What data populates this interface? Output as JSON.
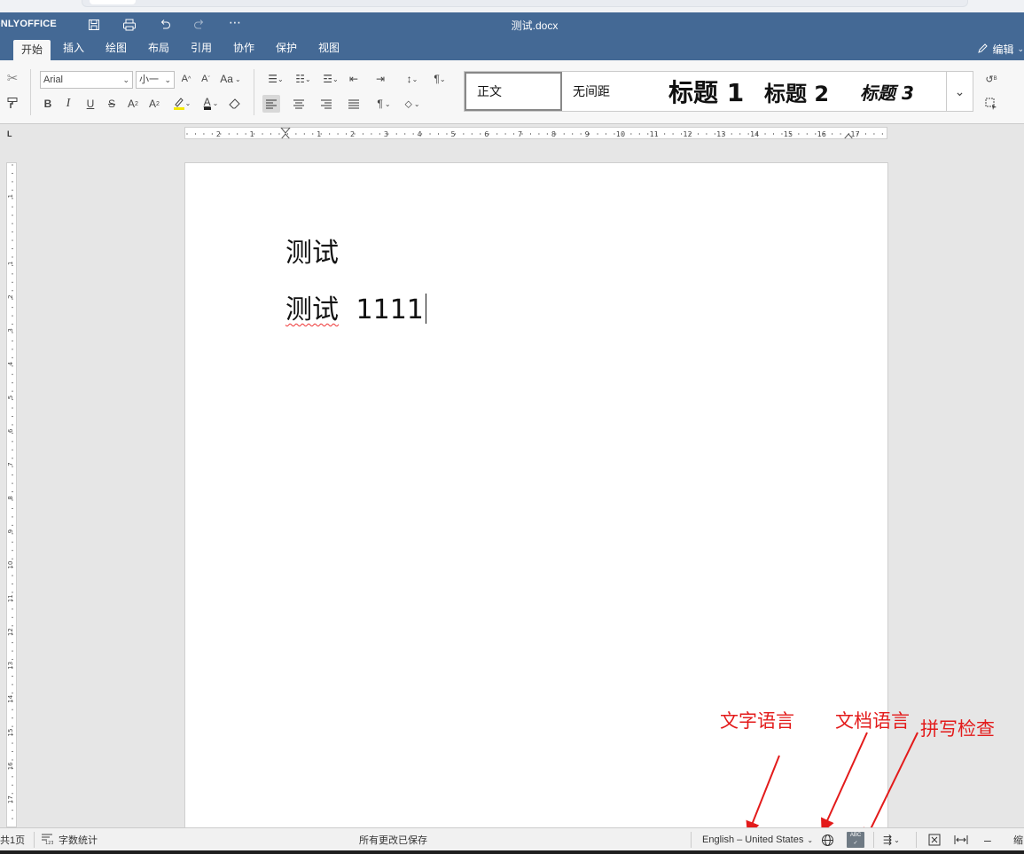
{
  "app": {
    "logo_text": "ONLYOFFICE",
    "doc_title": "测试.docx"
  },
  "quick_access": [
    "save-icon",
    "print-icon",
    "undo-icon",
    "redo-icon",
    "more-icon"
  ],
  "tabs": [
    {
      "label": "开始",
      "active": true
    },
    {
      "label": "插入"
    },
    {
      "label": "绘图"
    },
    {
      "label": "布局"
    },
    {
      "label": "引用"
    },
    {
      "label": "协作"
    },
    {
      "label": "保护"
    },
    {
      "label": "视图"
    }
  ],
  "mode": {
    "label": "编辑",
    "icon": "pencil-icon"
  },
  "font": {
    "name": "Arial",
    "size": "小一"
  },
  "styles": [
    {
      "label": "正文"
    },
    {
      "label": "无间距"
    },
    {
      "label": "标题 1"
    },
    {
      "label": "标题 2"
    },
    {
      "label": "标题 3"
    }
  ],
  "ruler": {
    "h_numbers": [
      "2",
      "1",
      "1",
      "2",
      "3",
      "4",
      "5",
      "6",
      "7",
      "8",
      "9",
      "10",
      "11",
      "12",
      "13",
      "14",
      "15",
      "16",
      "17"
    ],
    "v_numbers": [
      "1",
      "1",
      "2",
      "3",
      "4",
      "5",
      "6",
      "7",
      "8",
      "9",
      "10",
      "11",
      "12",
      "13",
      "14",
      "15",
      "16",
      "17"
    ],
    "corner": "L"
  },
  "document": {
    "line1": "测试",
    "line2_cn": "测试",
    "line2_num": "1111"
  },
  "annotations": {
    "text_lang": "文字语言",
    "doc_lang": "文档语言",
    "spell_check": "拼写检查",
    "color": "#e31b1b"
  },
  "status": {
    "page_info": "共1页",
    "word_count": "字数统计",
    "save_state": "所有更改已保存",
    "language": "English – United States",
    "zoom_label": "缩"
  },
  "colors": {
    "brand": "#446995",
    "annotation": "#e31b1b"
  }
}
